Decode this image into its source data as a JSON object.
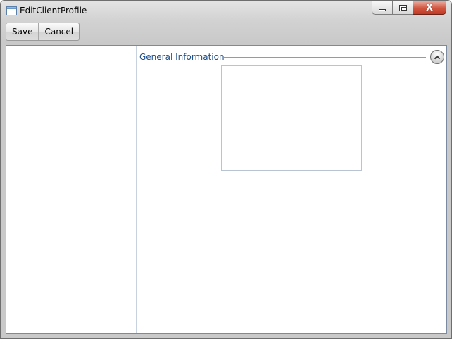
{
  "window": {
    "title": "EditClientProfile",
    "icon": "app-window-icon",
    "controls": {
      "minimize_icon": "minimize-icon",
      "maximize_icon": "maximize-icon",
      "close_glyph": "X"
    }
  },
  "toolbar": {
    "save_label": "Save",
    "cancel_label": "Cancel"
  },
  "main": {
    "section": {
      "title": "General Information",
      "collapse_icon": "chevron-up-icon"
    }
  },
  "colors": {
    "section_title": "#1f4f8c",
    "close_button": "#c23a24",
    "content_border": "#7a8aa0"
  }
}
